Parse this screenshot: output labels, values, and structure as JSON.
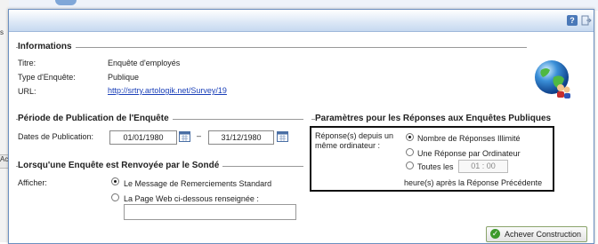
{
  "background": {
    "left_fragment_top": "s",
    "left_fragment_bottom": "Ac"
  },
  "window": {
    "help_button_label": "?"
  },
  "informations": {
    "section_title": "Informations",
    "titre_label": "Titre:",
    "titre_value": "Enquête d'employés",
    "type_label": "Type d'Enquête:",
    "type_value": "Publique",
    "url_label": "URL:",
    "url_value": "http://srtry.artologik.net/Survey/19"
  },
  "publication": {
    "section_title": "Période de Publication de l'Enquête",
    "dates_label": "Dates de Publication:",
    "start_date": "01/01/1980",
    "separator": "–",
    "end_date": "31/12/1980"
  },
  "renvoyee": {
    "section_title": "Lorsqu'une Enquête est Renvoyée par le Sondé",
    "afficher_label": "Afficher:",
    "options": [
      {
        "label": "Le Message de Remerciements Standard",
        "checked": true
      },
      {
        "label": "La Page Web ci-dessous renseignée :",
        "checked": false
      }
    ],
    "url_input_value": ""
  },
  "parametres": {
    "section_title": "Paramètres pour les Réponses aux Enquêtes Publiques",
    "reponses_label_line1": "Réponse(s) depuis un",
    "reponses_label_line2": "même ordinateur :",
    "options": [
      {
        "label": "Nombre de Réponses Illimité",
        "checked": true
      },
      {
        "label": "Une Réponse par Ordinateur",
        "checked": false
      },
      {
        "label": "Toutes les",
        "checked": false
      }
    ],
    "time_value": "01 : 00",
    "after_text": "heure(s) après la Réponse Précédente"
  },
  "footer": {
    "finish_button_label": "Achever Construction"
  },
  "colors": {
    "titlebar": "#c7d9f0",
    "link": "#1a3fb8",
    "button_icon": "#3d9a2c"
  },
  "icons": [
    "help-icon",
    "exit-icon",
    "calendar-icon",
    "globe-users-icon",
    "checkmark-icon"
  ]
}
